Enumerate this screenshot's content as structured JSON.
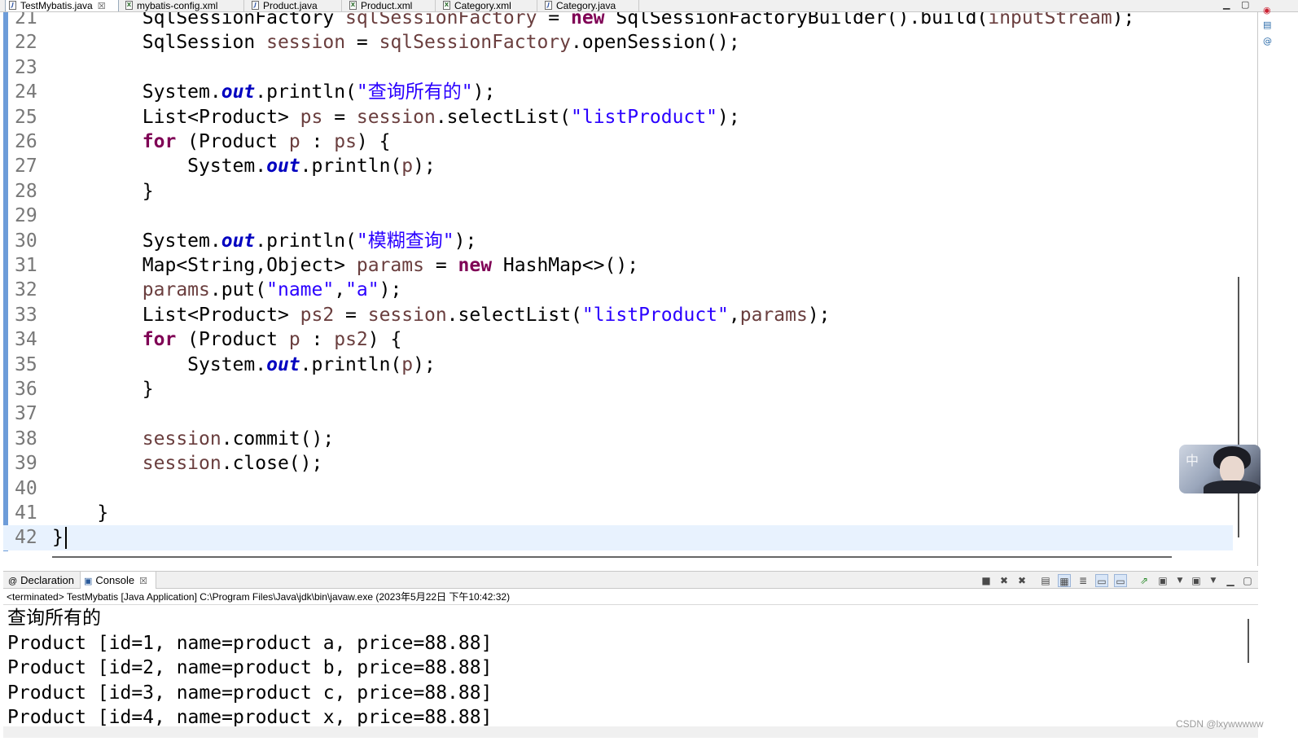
{
  "editor_tabs": [
    {
      "label": "TestMybatis.java",
      "type": "java",
      "close": "☒",
      "active": true
    },
    {
      "label": "mybatis-config.xml",
      "type": "xml"
    },
    {
      "label": "Product.java",
      "type": "java"
    },
    {
      "label": "Product.xml",
      "type": "xml"
    },
    {
      "label": "Category.xml",
      "type": "xml"
    },
    {
      "label": "Category.java",
      "type": "java"
    }
  ],
  "code_lines": [
    {
      "n": "21",
      "segs": [
        [
          "t",
          "        SqlSessionFactory "
        ],
        [
          "v",
          "sqlSessionFactory"
        ],
        [
          "t",
          " = "
        ],
        [
          "k",
          "new"
        ],
        [
          "t",
          " SqlSessionFactoryBuilder().build("
        ],
        [
          "v",
          "inputStream"
        ],
        [
          "t",
          ");"
        ]
      ]
    },
    {
      "n": "22",
      "segs": [
        [
          "t",
          "        SqlSession "
        ],
        [
          "v",
          "session"
        ],
        [
          "t",
          " = "
        ],
        [
          "v",
          "sqlSessionFactory"
        ],
        [
          "t",
          ".openSession();"
        ]
      ]
    },
    {
      "n": "23",
      "segs": []
    },
    {
      "n": "24",
      "segs": [
        [
          "t",
          "        System."
        ],
        [
          "f",
          "out"
        ],
        [
          "t",
          ".println("
        ],
        [
          "s",
          "\"查询所有的\""
        ],
        [
          "t",
          ");"
        ]
      ]
    },
    {
      "n": "25",
      "segs": [
        [
          "t",
          "        List<Product> "
        ],
        [
          "v",
          "ps"
        ],
        [
          "t",
          " = "
        ],
        [
          "v",
          "session"
        ],
        [
          "t",
          ".selectList("
        ],
        [
          "s",
          "\"listProduct\""
        ],
        [
          "t",
          ");"
        ]
      ]
    },
    {
      "n": "26",
      "segs": [
        [
          "t",
          "        "
        ],
        [
          "k",
          "for"
        ],
        [
          "t",
          " (Product "
        ],
        [
          "v",
          "p"
        ],
        [
          "t",
          " : "
        ],
        [
          "v",
          "ps"
        ],
        [
          "t",
          ") {"
        ]
      ]
    },
    {
      "n": "27",
      "segs": [
        [
          "t",
          "            System."
        ],
        [
          "f",
          "out"
        ],
        [
          "t",
          ".println("
        ],
        [
          "v",
          "p"
        ],
        [
          "t",
          ");"
        ]
      ]
    },
    {
      "n": "28",
      "segs": [
        [
          "t",
          "        }"
        ]
      ]
    },
    {
      "n": "29",
      "segs": []
    },
    {
      "n": "30",
      "segs": [
        [
          "t",
          "        System."
        ],
        [
          "f",
          "out"
        ],
        [
          "t",
          ".println("
        ],
        [
          "s",
          "\"模糊查询\""
        ],
        [
          "t",
          ");"
        ]
      ]
    },
    {
      "n": "31",
      "segs": [
        [
          "t",
          "        Map<String,Object> "
        ],
        [
          "v",
          "params"
        ],
        [
          "t",
          " = "
        ],
        [
          "k",
          "new"
        ],
        [
          "t",
          " HashMap<>();"
        ]
      ]
    },
    {
      "n": "32",
      "segs": [
        [
          "t",
          "        "
        ],
        [
          "v",
          "params"
        ],
        [
          "t",
          ".put("
        ],
        [
          "s",
          "\"name\""
        ],
        [
          "t",
          ","
        ],
        [
          "s",
          "\"a\""
        ],
        [
          "t",
          ");"
        ]
      ]
    },
    {
      "n": "33",
      "segs": [
        [
          "t",
          "        List<Product> "
        ],
        [
          "v",
          "ps2"
        ],
        [
          "t",
          " = "
        ],
        [
          "v",
          "session"
        ],
        [
          "t",
          ".selectList("
        ],
        [
          "s",
          "\"listProduct\""
        ],
        [
          "t",
          ","
        ],
        [
          "v",
          "params"
        ],
        [
          "t",
          ");"
        ]
      ]
    },
    {
      "n": "34",
      "segs": [
        [
          "t",
          "        "
        ],
        [
          "k",
          "for"
        ],
        [
          "t",
          " (Product "
        ],
        [
          "v",
          "p"
        ],
        [
          "t",
          " : "
        ],
        [
          "v",
          "ps2"
        ],
        [
          "t",
          ") {"
        ]
      ]
    },
    {
      "n": "35",
      "segs": [
        [
          "t",
          "            System."
        ],
        [
          "f",
          "out"
        ],
        [
          "t",
          ".println("
        ],
        [
          "v",
          "p"
        ],
        [
          "t",
          ");"
        ]
      ]
    },
    {
      "n": "36",
      "segs": [
        [
          "t",
          "        }"
        ]
      ]
    },
    {
      "n": "37",
      "segs": []
    },
    {
      "n": "38",
      "segs": [
        [
          "t",
          "        "
        ],
        [
          "v",
          "session"
        ],
        [
          "t",
          ".commit();"
        ]
      ]
    },
    {
      "n": "39",
      "segs": [
        [
          "t",
          "        "
        ],
        [
          "v",
          "session"
        ],
        [
          "t",
          ".close();"
        ]
      ]
    },
    {
      "n": "40",
      "segs": []
    },
    {
      "n": "41",
      "segs": [
        [
          "t",
          "    }"
        ]
      ]
    },
    {
      "n": "42",
      "segs": [
        [
          "t",
          "}"
        ]
      ],
      "current": true
    }
  ],
  "console": {
    "tabs": [
      {
        "label": "Declaration",
        "icon": "@"
      },
      {
        "label": "Console",
        "icon": "▣",
        "close": "☒",
        "active": true
      }
    ],
    "status": "<terminated> TestMybatis [Java Application] C:\\Program Files\\Java\\jdk\\bin\\javaw.exe (2023年5月22日 下午10:42:32)",
    "output": [
      "查询所有的",
      "Product [id=1, name=product a, price=88.88]",
      "Product [id=2, name=product b, price=88.88]",
      "Product [id=3, name=product c, price=88.88]",
      "Product [id=4, name=product x, price=88.88]"
    ]
  },
  "avatar_text": "中",
  "watermark": "CSDN @lxywwwww",
  "colors": {
    "keyword": "#7f0055",
    "string": "#2a00ff",
    "variable": "#6a3e3e",
    "field": "#0000c0",
    "ruler": "#6d9cd9",
    "current_line": "#e8f2fe"
  }
}
